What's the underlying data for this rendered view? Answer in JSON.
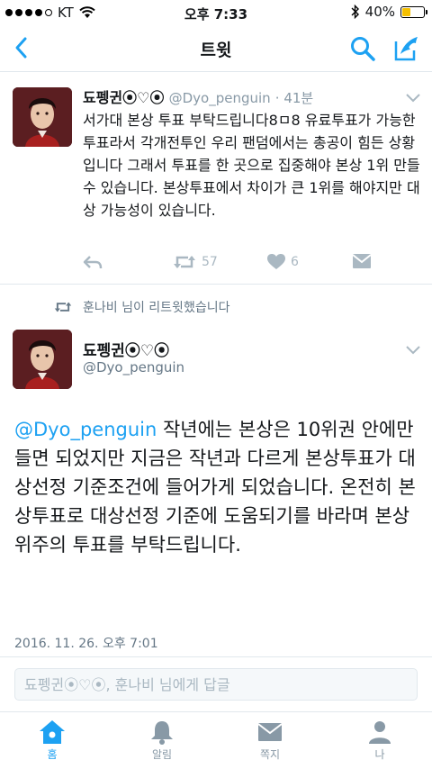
{
  "status_bar": {
    "carrier": "KT",
    "time": "오후 7:33",
    "battery": "40%",
    "battery_level": 0.4,
    "icons": [
      "signal-dots-icon",
      "wifi-icon",
      "bluetooth-icon",
      "battery-icon"
    ]
  },
  "nav": {
    "title": "트윗",
    "icons": [
      "back-chevron-icon",
      "search-icon",
      "compose-icon"
    ],
    "accent": "#1da1f2"
  },
  "tweet1": {
    "name": "됴펭귄⦿♡⦿",
    "handle": "@Dyo_penguin",
    "time": "· 41분",
    "text": "서가대 본상 투표 부탁드립니다8ㅁ8 유료투표가 가능한 투표라서 각개전투인 우리 팬덤에서는 총공이 힘든 상황입니다 그래서 투표를 한 곳으로 집중해야 본상 1위 만들 수 있습니다. 본상투표에서 차이가 큰 1위를 해야지만 대상 가능성이 있습니다.",
    "retweet_count": "57",
    "like_count": "6"
  },
  "retweet_context": {
    "text": "훈나비 님이 리트윗했습니다"
  },
  "tweet2": {
    "name": "됴펭귄⦿♡⦿",
    "handle": "@Dyo_penguin",
    "mention": "@Dyo_penguin",
    "text": " 작년에는 본상은 10위권 안에만 들면 되었지만 지금은 작년과 다르게 본상투표가 대상선정 기준조건에 들어가게 되었습니다. 온전히 본상투표로 대상선정 기준에 도움되기를 바라며 본상 위주의 투표를 부탁드립니다.",
    "date": "2016. 11. 26. 오후 7:01"
  },
  "reply": {
    "placeholder": "됴펭귄⦿♡⦿, 훈나비 님에게 답글"
  },
  "tabs": [
    {
      "label": "홈",
      "icon": "home-icon",
      "active": true
    },
    {
      "label": "알림",
      "icon": "bell-icon",
      "active": false
    },
    {
      "label": "쪽지",
      "icon": "envelope-icon",
      "active": false
    },
    {
      "label": "나",
      "icon": "person-icon",
      "active": false
    }
  ]
}
